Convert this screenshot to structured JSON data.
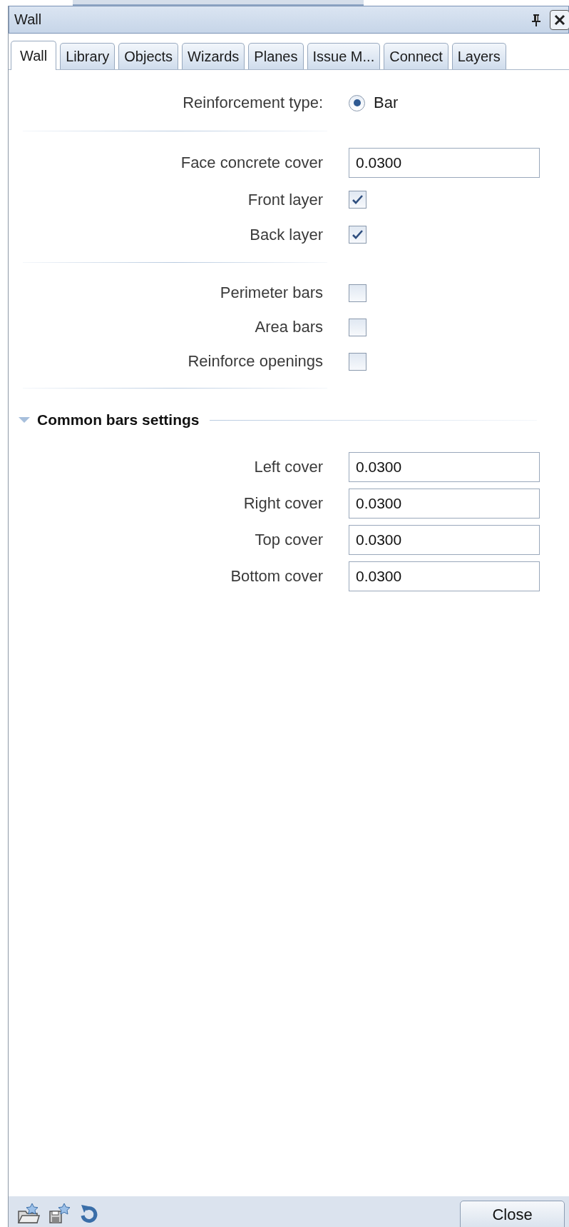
{
  "window": {
    "title": "Wall"
  },
  "tabs": [
    {
      "label": "Wall",
      "selected": true
    },
    {
      "label": "Library",
      "selected": false
    },
    {
      "label": "Objects",
      "selected": false
    },
    {
      "label": "Wizards",
      "selected": false
    },
    {
      "label": "Planes",
      "selected": false
    },
    {
      "label": "Issue M...",
      "selected": false
    },
    {
      "label": "Connect",
      "selected": false
    },
    {
      "label": "Layers",
      "selected": false
    }
  ],
  "reinforcement_type": {
    "label": "Reinforcement type:",
    "option": "Bar",
    "selected": true
  },
  "face_concrete_cover": {
    "label": "Face concrete cover",
    "value": "0.0300"
  },
  "layers": [
    {
      "label": "Front layer",
      "checked": true
    },
    {
      "label": "Back layer",
      "checked": true
    }
  ],
  "options": [
    {
      "label": "Perimeter bars",
      "checked": false
    },
    {
      "label": "Area bars",
      "checked": false
    },
    {
      "label": "Reinforce openings",
      "checked": false
    }
  ],
  "section": {
    "title": "Common bars settings",
    "expanded": true,
    "fields": [
      {
        "label": "Left cover",
        "value": "0.0300"
      },
      {
        "label": "Right cover",
        "value": "0.0300"
      },
      {
        "label": "Top cover",
        "value": "0.0300"
      },
      {
        "label": "Bottom cover",
        "value": "0.0300"
      }
    ]
  },
  "footer": {
    "close": "Close"
  }
}
